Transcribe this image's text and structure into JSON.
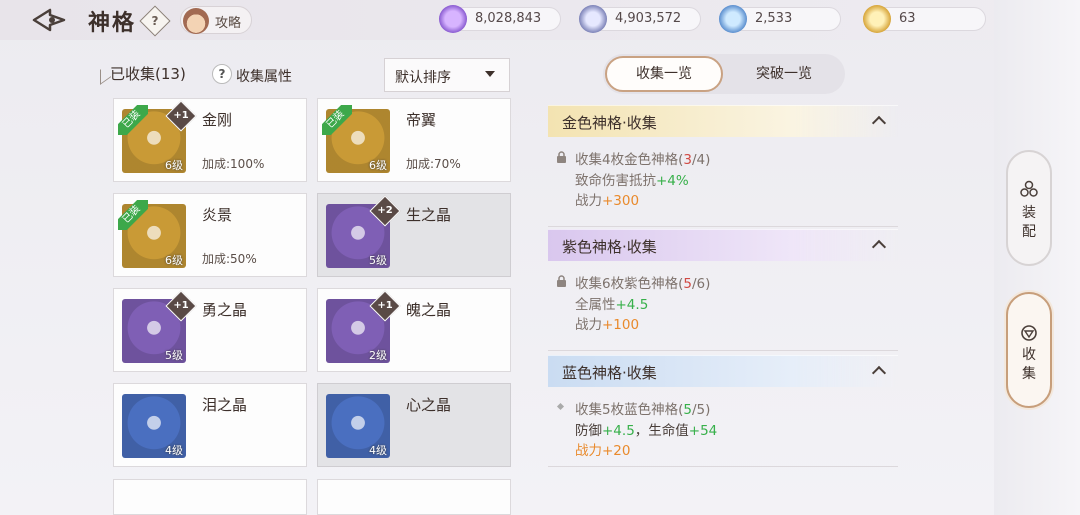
{
  "header": {
    "title": "神格",
    "help": "?",
    "guide_label": "攻略",
    "resources": [
      {
        "icon": "crystal-book-icon",
        "value": "8,028,843"
      },
      {
        "icon": "silver-coin-icon",
        "value": "4,903,572"
      },
      {
        "icon": "blue-orb-icon",
        "value": "2,533"
      },
      {
        "icon": "gold-coin-icon",
        "value": "63"
      }
    ]
  },
  "left": {
    "collected_label": "已收集(13)",
    "help": "?",
    "attr_label": "收集属性",
    "sort_label": "默认排序",
    "equipped_tag": "已装",
    "cards": [
      {
        "name": "金刚",
        "level": "6级",
        "plus": "+1",
        "bonus": "加成:100%",
        "equipped": true,
        "color": "#c99a36"
      },
      {
        "name": "帝翼",
        "level": "6级",
        "plus": "",
        "bonus": "加成:70%",
        "equipped": true,
        "color": "#c99a36"
      },
      {
        "name": "炎景",
        "level": "6级",
        "plus": "",
        "bonus": "加成:50%",
        "equipped": true,
        "color": "#c99a36"
      },
      {
        "name": "生之晶",
        "level": "5级",
        "plus": "+2",
        "bonus": "",
        "equipped": false,
        "color": "#7f5fb5"
      },
      {
        "name": "勇之晶",
        "level": "5级",
        "plus": "+1",
        "bonus": "",
        "equipped": false,
        "color": "#7f5fb5"
      },
      {
        "name": "魄之晶",
        "level": "2级",
        "plus": "+1",
        "bonus": "",
        "equipped": false,
        "color": "#7f5fb5"
      },
      {
        "name": "泪之晶",
        "level": "4级",
        "plus": "",
        "bonus": "",
        "equipped": false,
        "color": "#4a6fc0"
      },
      {
        "name": "心之晶",
        "level": "4级",
        "plus": "",
        "bonus": "",
        "equipped": false,
        "color": "#4a6fc0"
      }
    ]
  },
  "tabs": {
    "active": "收集一览",
    "other": "突破一览"
  },
  "sections": [
    {
      "title": "金色神格·收集",
      "cond_prefix": "收集4枚金色神格(",
      "cond_have": "3",
      "cond_total": "/4)",
      "attr_name": "致命伤害抵抗",
      "attr_val": "+4%",
      "power_label": "战力",
      "power_val": "+300",
      "bg": "#f5e6b8"
    },
    {
      "title": "紫色神格·收集",
      "cond_prefix": "收集6枚紫色神格(",
      "cond_have": "5",
      "cond_total": "/6)",
      "attr_name": "全属性",
      "attr_val": "+4.5",
      "power_label": "战力",
      "power_val": "+100",
      "bg": "#dccbee"
    },
    {
      "title": "蓝色神格·收集",
      "cond_prefix": "收集5枚蓝色神格(",
      "cond_have": "5",
      "cond_total": "/5)",
      "attr_name": "防御",
      "attr_val": "+4.5",
      "attr2_sep": "，",
      "attr2_name": "生命值",
      "attr2_val": "+54",
      "power_label": "战力",
      "power_val": "+20",
      "bg": "#cfe0f3"
    }
  ],
  "side": {
    "equip": [
      "装",
      "配"
    ],
    "collect": [
      "收",
      "集"
    ]
  }
}
